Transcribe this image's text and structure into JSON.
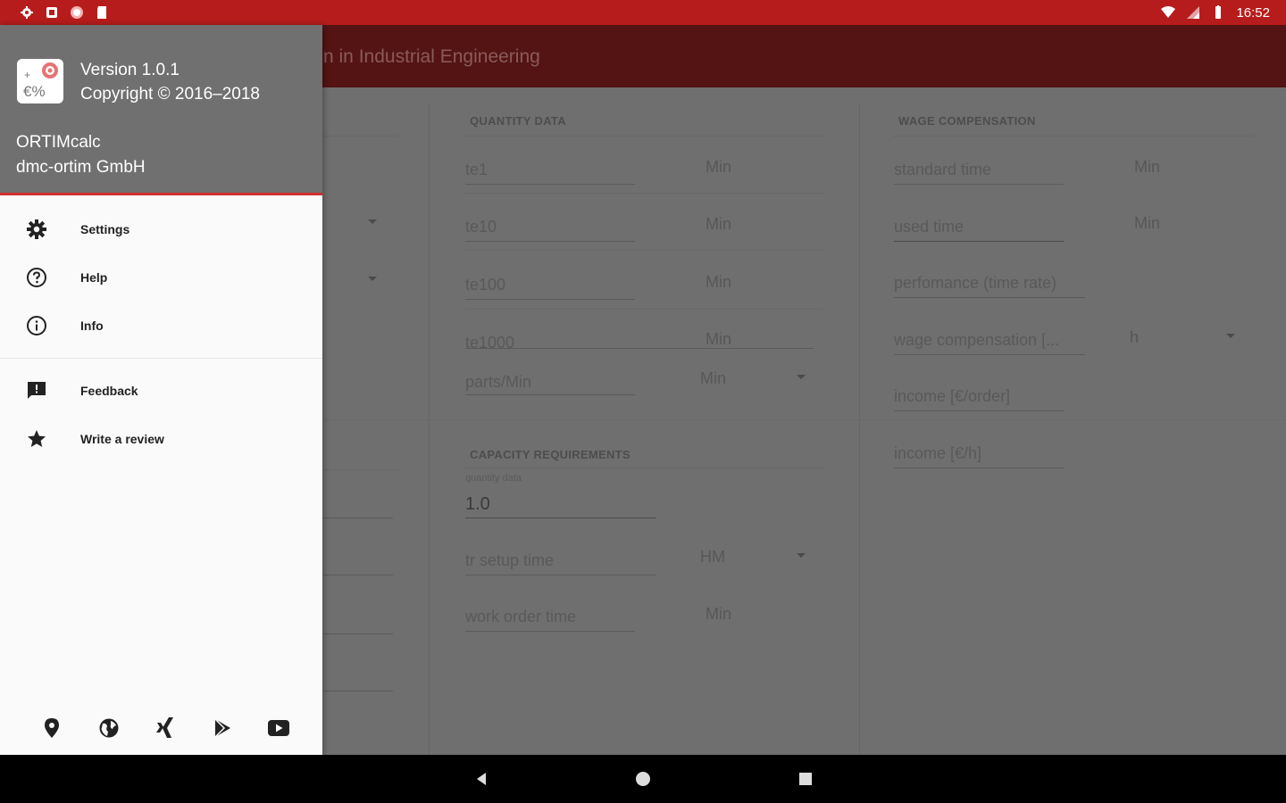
{
  "status_bar": {
    "time": "16:52",
    "left_icons": [
      "settings-icon",
      "notification-icon",
      "record-icon",
      "sd-card-icon"
    ],
    "right_icons": [
      "wifi-icon",
      "signal-icon",
      "battery-icon"
    ]
  },
  "app_bar": {
    "title": "n in Industrial Engineering"
  },
  "content": {
    "quantity_data": {
      "title": "QUANTITY DATA",
      "rows": [
        {
          "label": "te1",
          "unit": "Min"
        },
        {
          "label": "te10",
          "unit": "Min"
        },
        {
          "label": "te100",
          "unit": "Min"
        },
        {
          "label": "te1000",
          "unit": "Min"
        },
        {
          "label": "parts/Min",
          "unit": "Min"
        }
      ]
    },
    "capacity": {
      "title": "CAPACITY REQUIREMENTS",
      "sub_label": "quantity data",
      "value": "1.0",
      "rows": [
        {
          "label": "tr setup time",
          "unit": "HM"
        },
        {
          "label": "work order time",
          "unit": "Min"
        }
      ]
    },
    "wage": {
      "title": "WAGE COMPENSATION",
      "rows": [
        {
          "label": "standard time",
          "unit": "Min"
        },
        {
          "label": "used time",
          "unit": "Min"
        },
        {
          "label": "perfomance (time rate)",
          "unit": ""
        },
        {
          "label": "wage compensation [...",
          "unit": "h"
        },
        {
          "label": "income [€/order]",
          "unit": ""
        },
        {
          "label": "income [€/h]",
          "unit": ""
        }
      ]
    }
  },
  "drawer": {
    "header": {
      "version": "Version 1.0.1",
      "copyright": "Copyright © 2016–2018",
      "app_name": "ORTIMcalc",
      "company": "dmc-ortim GmbH",
      "logo_text": "€%"
    },
    "menu": [
      {
        "label": "Settings",
        "icon": "gear-icon"
      },
      {
        "label": "Help",
        "icon": "help-circle-icon"
      },
      {
        "label": "Info",
        "icon": "info-circle-icon"
      }
    ],
    "menu2": [
      {
        "label": "Feedback",
        "icon": "feedback-icon"
      },
      {
        "label": "Write a review",
        "icon": "star-icon"
      }
    ],
    "social": [
      "location-pin-icon",
      "globe-icon",
      "xing-icon",
      "play-store-icon",
      "youtube-icon"
    ]
  },
  "nav_bar": {
    "buttons": [
      "back-icon",
      "home-icon",
      "recents-icon"
    ]
  }
}
